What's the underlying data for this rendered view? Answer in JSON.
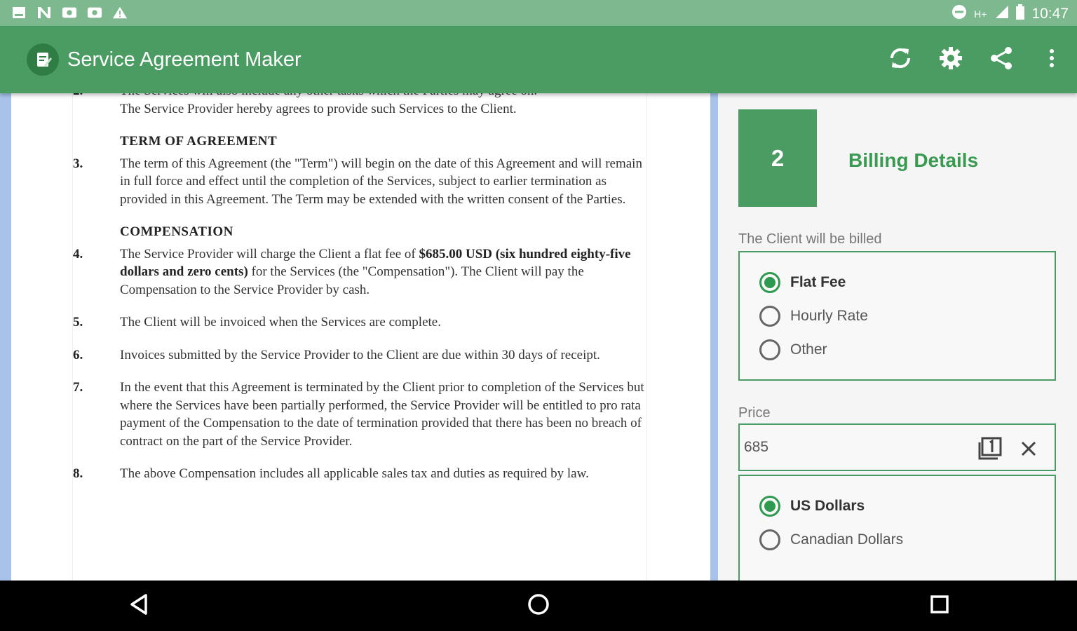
{
  "status_bar": {
    "left_icons": [
      "gallery-notification-icon",
      "n-notification-icon",
      "mail-notification-icon",
      "mail-notification-icon",
      "warning-icon"
    ],
    "network": "H+",
    "time": "10:47"
  },
  "app_bar": {
    "title": "Service Agreement Maker",
    "actions": [
      "refresh-icon",
      "settings-icon",
      "share-icon",
      "more-vert-icon"
    ],
    "color": "#4a9c62"
  },
  "document": {
    "top_partial_line": "The Services will also include any other tasks which the Parties may agree on.",
    "intro_line": "The Service Provider hereby agrees to provide such Services to the Client.",
    "term_heading": "TERM OF AGREEMENT",
    "compensation_heading": "COMPENSATION",
    "paragraphs": {
      "p3": {
        "num": "3.",
        "text": "The term of this Agreement (the \"Term\") will begin on the date of this Agreement and will remain in full force and effect until the completion of the Services, subject to earlier termination as provided in this Agreement. The Term may be extended with the written consent of the Parties."
      },
      "p4": {
        "num": "4.",
        "text_before": "The Service Provider will charge the Client a flat fee of ",
        "bold": "$685.00 USD (six hundred eighty-five dollars and zero cents)",
        "text_after": " for the Services (the \"Compensation\"). The Client will pay the Compensation to the Service Provider by cash."
      },
      "p5": {
        "num": "5.",
        "text": "The Client will be invoiced when the Services are complete."
      },
      "p6": {
        "num": "6.",
        "text": "Invoices submitted by the Service Provider to the Client are due within 30 days of receipt."
      },
      "p7": {
        "num": "7.",
        "text": "In the event that this Agreement is terminated by the Client prior to completion of the Services but where the Services have been partially performed, the Service Provider will be entitled to pro rata payment of the Compensation to the date of termination provided that there has been no breach of contract on the part of the Service Provider."
      },
      "p8": {
        "num": "8.",
        "text": "The above Compensation includes all applicable sales tax and duties as required by law."
      }
    }
  },
  "form": {
    "step_number": "2",
    "step_title": "Billing Details",
    "billing_label": "The Client will be billed",
    "billing_options": {
      "flat_fee": "Flat Fee",
      "hourly_rate": "Hourly Rate",
      "other": "Other"
    },
    "billing_selected": "Flat Fee",
    "price_label": "Price",
    "price_value": "685",
    "price_icons": [
      "number-pad-icon",
      "clear-icon"
    ],
    "currency_options": {
      "usd": "US Dollars",
      "cad": "Canadian Dollars"
    },
    "currency_selected": "US Dollars",
    "accent_color": "#2e9a4f"
  },
  "nav_bar": {
    "buttons": [
      "back-icon",
      "home-icon",
      "recents-icon"
    ]
  }
}
